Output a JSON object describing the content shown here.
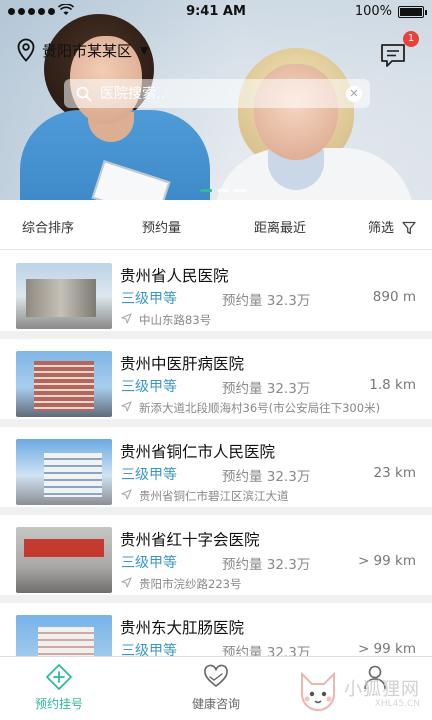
{
  "status_bar": {
    "time": "9:41 AM",
    "battery": "100%"
  },
  "header": {
    "location": "贵阳市某某区",
    "message_badge": "1",
    "search_placeholder": "医院搜索.."
  },
  "banner": {
    "slide_count": 3,
    "active_slide": 0
  },
  "filters": {
    "tabs": [
      "综合排序",
      "预约量",
      "距离最近"
    ],
    "filter_label": "筛选"
  },
  "hospitals": [
    {
      "name": "贵州省人民医院",
      "level": "三级甲等",
      "appointments": "预约量 32.3万",
      "distance": "890 m",
      "address": "中山东路83号"
    },
    {
      "name": "贵州中医肝病医院",
      "level": "三级甲等",
      "appointments": "预约量 32.3万",
      "distance": "1.8 km",
      "address": "新添大道北段顺海村36号(市公安局往下300米)"
    },
    {
      "name": "贵州省铜仁市人民医院",
      "level": "三级甲等",
      "appointments": "预约量 32.3万",
      "distance": "23 km",
      "address": "贵州省铜仁市碧江区滨江大道"
    },
    {
      "name": "贵州省红十字会医院",
      "level": "三级甲等",
      "appointments": "预约量 32.3万",
      "distance": "> 99 km",
      "address": "贵阳市浣纱路223号"
    },
    {
      "name": "贵州东大肛肠医院",
      "level": "三级甲等",
      "appointments": "预约量 32.3万",
      "distance": "> 99 km",
      "address": ""
    }
  ],
  "tabbar": {
    "items": [
      "预约挂号",
      "健康咨询"
    ],
    "active_color": "#2fb89a"
  },
  "watermark": {
    "text": "小狐狸网",
    "sub": "XHL45.CN"
  },
  "colors": {
    "accent": "#2fb89a",
    "level_blue": "#3b96cf",
    "badge_red": "#e8423a"
  }
}
